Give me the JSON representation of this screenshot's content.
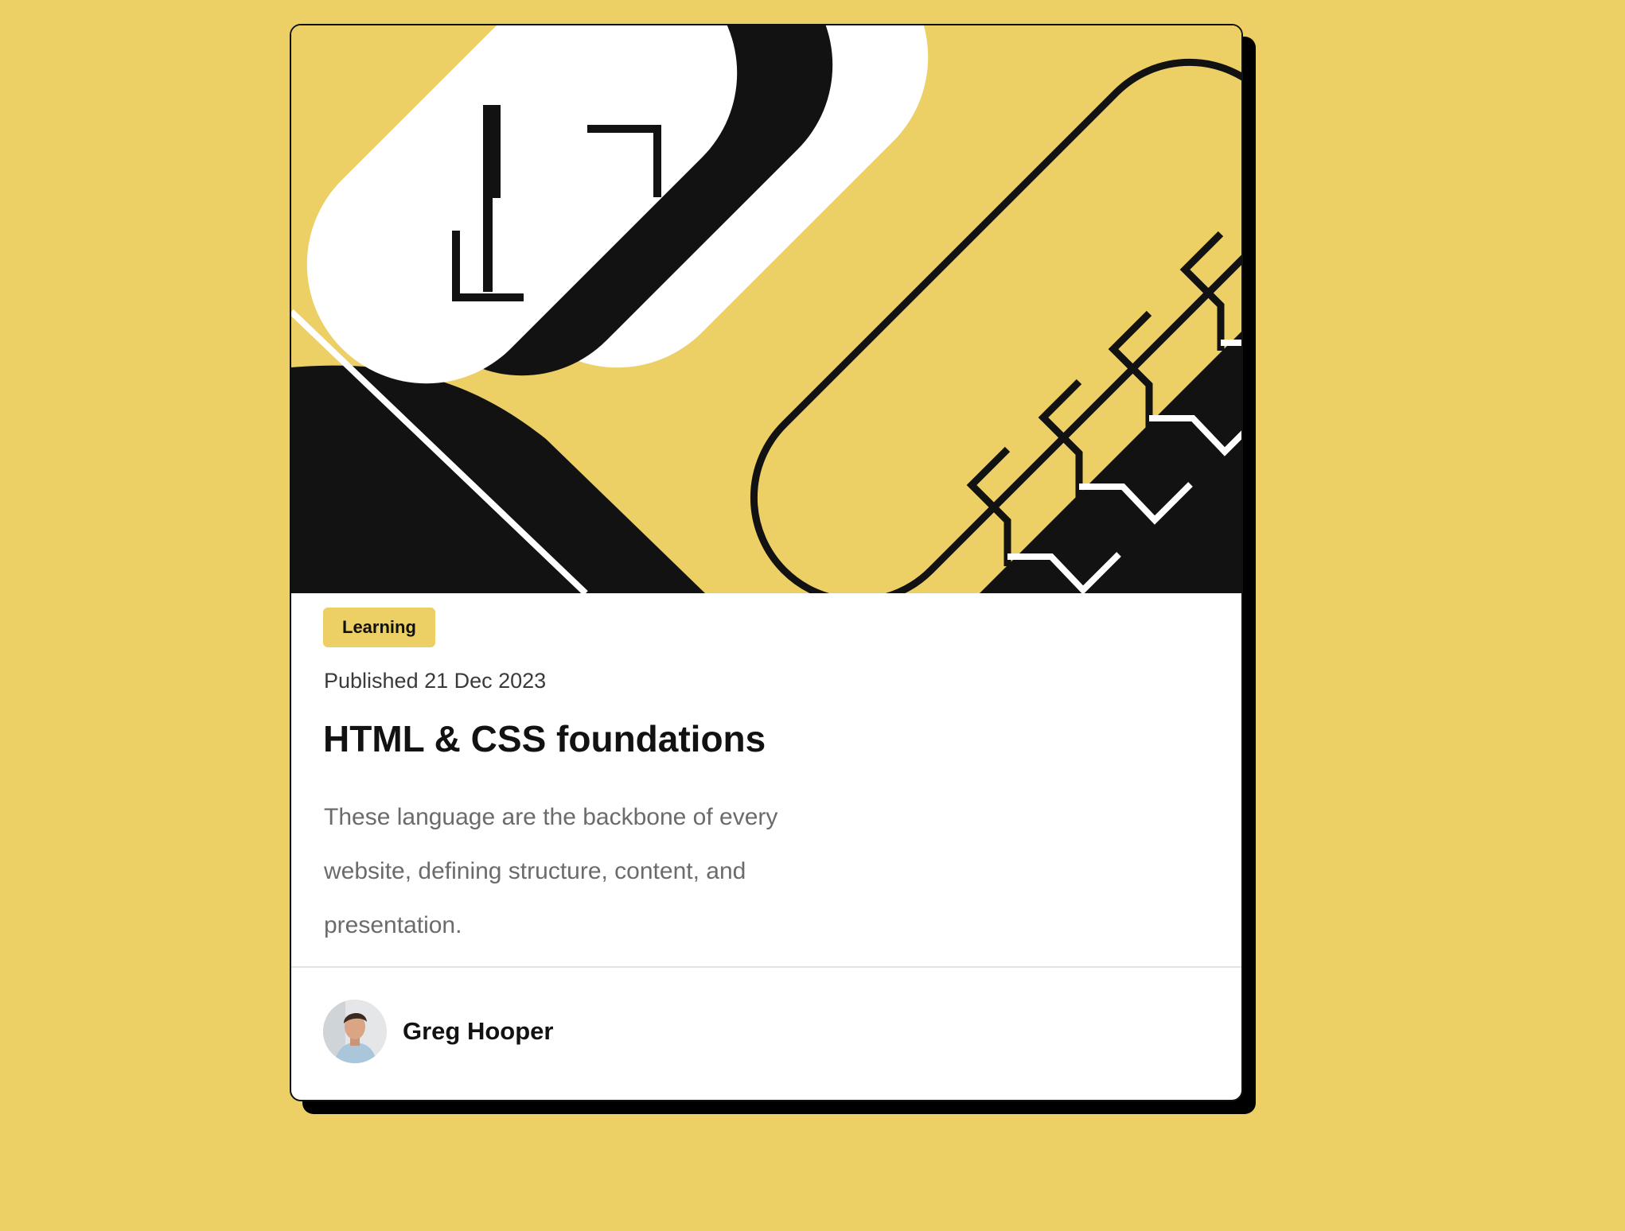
{
  "card": {
    "tag": "Learning",
    "published": "Published 21 Dec 2023",
    "title": "HTML & CSS foundations",
    "description": "These language are the backbone of every website, defining structure, content, and presentation."
  },
  "author": {
    "name": "Greg Hooper"
  },
  "colors": {
    "background": "#ECD065",
    "card": "#FFFFFF",
    "ink": "#121212",
    "shadow": "#000000",
    "muted_text": "#6B6B6B"
  },
  "icons": {
    "hero": "html-css-illustration",
    "avatar": "author-avatar"
  }
}
